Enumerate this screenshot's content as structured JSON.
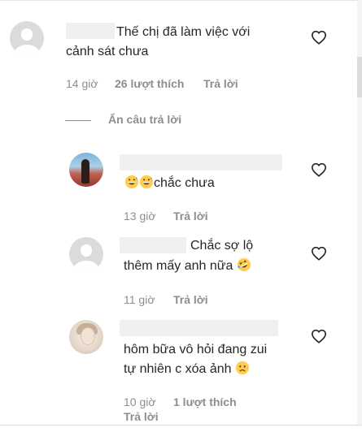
{
  "comments": [
    {
      "text_lines": [
        "Thế chị đã làm việc với",
        "cảnh sát chưa"
      ],
      "time": "14 giờ",
      "likes": "26 lượt thích",
      "reply": "Trả lời",
      "avatar": "default-avatar"
    }
  ],
  "hide_replies_label": "Ẩn câu trả lời",
  "replies": [
    {
      "text_lines": [
        "chắc chưa"
      ],
      "emojis_before": [
        "grinning-sweat-emoji",
        "grinning-sweat-emoji"
      ],
      "time": "13 giờ",
      "reply": "Trả lời",
      "avatar": "photo-avatar"
    },
    {
      "text_lines": [
        "Chắc sợ lộ",
        "thêm mấy anh nữa"
      ],
      "emoji_after": "rolling-laughing-emoji",
      "time": "11 giờ",
      "reply": "Trả lời",
      "avatar": "default-avatar"
    },
    {
      "text_lines": [
        "hôm bữa vô hỏi đang zui",
        "tự nhiên c xóa ảnh"
      ],
      "emoji_after": "sad-face-emoji",
      "time": "10 giờ",
      "likes": "1 lượt thích",
      "reply": "Trả lời",
      "avatar": "photo-avatar"
    }
  ],
  "colors": {
    "text": "#262626",
    "meta": "#8e8e8e",
    "placeholder_avatar": "#dbdbdb",
    "blur": "#efefef"
  }
}
